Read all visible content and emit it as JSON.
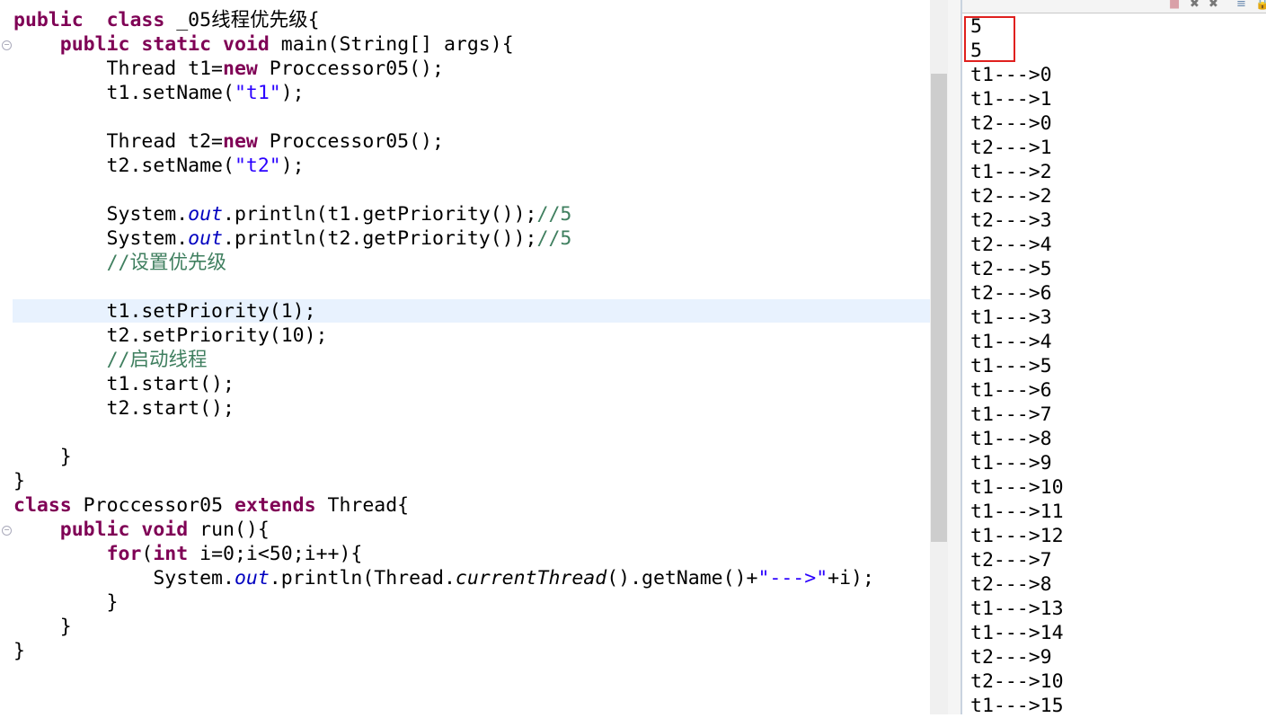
{
  "editor": {
    "highlighted_line": 12,
    "fold_markers": [
      1,
      21
    ],
    "lines": [
      [
        [
          "kw",
          "public"
        ],
        [
          "",
          "  "
        ],
        [
          "kw",
          "class"
        ],
        [
          "",
          " _05线程优先级{"
        ]
      ],
      [
        [
          "",
          "    "
        ],
        [
          "kw",
          "public"
        ],
        [
          "",
          " "
        ],
        [
          "kw",
          "static"
        ],
        [
          "",
          " "
        ],
        [
          "kw",
          "void"
        ],
        [
          "",
          " main(String[] args){"
        ]
      ],
      [
        [
          "",
          "        Thread t1="
        ],
        [
          "kw",
          "new"
        ],
        [
          "",
          " Proccessor05();"
        ]
      ],
      [
        [
          "",
          "        t1.setName("
        ],
        [
          "str",
          "\"t1\""
        ],
        [
          "",
          ");"
        ]
      ],
      [],
      [
        [
          "",
          "        Thread t2="
        ],
        [
          "kw",
          "new"
        ],
        [
          "",
          " Proccessor05();"
        ]
      ],
      [
        [
          "",
          "        t2.setName("
        ],
        [
          "str",
          "\"t2\""
        ],
        [
          "",
          ");"
        ]
      ],
      [],
      [
        [
          "",
          "        System."
        ],
        [
          "fld",
          "out"
        ],
        [
          "",
          ".println(t1.getPriority());"
        ],
        [
          "cm",
          "//5"
        ]
      ],
      [
        [
          "",
          "        System."
        ],
        [
          "fld",
          "out"
        ],
        [
          "",
          ".println(t2.getPriority());"
        ],
        [
          "cm",
          "//5"
        ]
      ],
      [
        [
          "",
          "        "
        ],
        [
          "cm",
          "//设置优先级"
        ]
      ],
      [],
      [
        [
          "",
          "        t1.setPriority(1);"
        ]
      ],
      [
        [
          "",
          "        t2.setPriority(10);"
        ]
      ],
      [
        [
          "",
          "        "
        ],
        [
          "cm",
          "//启动线程"
        ]
      ],
      [
        [
          "",
          "        t1.start();"
        ]
      ],
      [
        [
          "",
          "        t2.start();"
        ]
      ],
      [],
      [
        [
          "",
          "    }"
        ]
      ],
      [
        [
          "",
          "}"
        ]
      ],
      [
        [
          "kw",
          "class"
        ],
        [
          "",
          " Proccessor05 "
        ],
        [
          "kw",
          "extends"
        ],
        [
          "",
          " Thread{"
        ]
      ],
      [
        [
          "",
          "    "
        ],
        [
          "kw",
          "public"
        ],
        [
          "",
          " "
        ],
        [
          "kw",
          "void"
        ],
        [
          "",
          " run(){"
        ]
      ],
      [
        [
          "",
          "        "
        ],
        [
          "kw",
          "for"
        ],
        [
          "",
          "("
        ],
        [
          "kw",
          "int"
        ],
        [
          "",
          " i=0;i<50;i++){"
        ]
      ],
      [
        [
          "",
          "            System."
        ],
        [
          "fld",
          "out"
        ],
        [
          "",
          ".println(Thread."
        ],
        [
          "it",
          "currentThread"
        ],
        [
          "",
          "().getName()+"
        ],
        [
          "str",
          "\"--->\""
        ],
        [
          "",
          "+i);"
        ]
      ],
      [
        [
          "",
          "        }"
        ]
      ],
      [
        [
          "",
          "    }"
        ]
      ],
      [
        [
          "",
          "}"
        ]
      ]
    ]
  },
  "console": {
    "toolbar_icons": [
      "terminate-icon",
      "remove-launch-icon",
      "remove-all-icon",
      "clear-console-icon",
      "scroll-lock-icon"
    ],
    "highlight_color": "#e0201e",
    "lines": [
      "5",
      "5",
      "t1--->0",
      "t1--->1",
      "t2--->0",
      "t2--->1",
      "t1--->2",
      "t2--->2",
      "t2--->3",
      "t2--->4",
      "t2--->5",
      "t2--->6",
      "t1--->3",
      "t1--->4",
      "t1--->5",
      "t1--->6",
      "t1--->7",
      "t1--->8",
      "t1--->9",
      "t1--->10",
      "t1--->11",
      "t1--->12",
      "t2--->7",
      "t2--->8",
      "t1--->13",
      "t1--->14",
      "t2--->9",
      "t2--->10",
      "t1--->15"
    ]
  }
}
